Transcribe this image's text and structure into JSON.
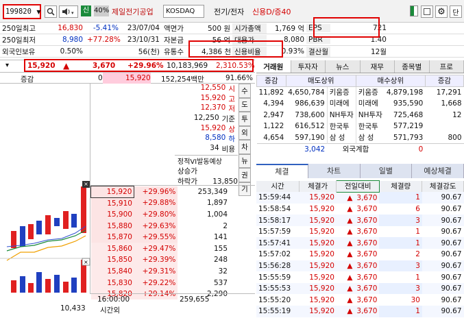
{
  "toolbar": {
    "stock_code": "199820",
    "market_badge": "신",
    "margin_rate": "40%",
    "stock_name": "제일전기공업",
    "market": "KOSDAQ",
    "sector": "전기/전자",
    "credit": "신용D/증40",
    "right_button": "단"
  },
  "summary": {
    "rows": [
      {
        "label": "250일최고",
        "price": "16,830",
        "pct": "-5.41%",
        "date": "23/07/04",
        "k1": "액면가",
        "v1": "500 원",
        "k2": "시가총액",
        "v2": "1,769 억",
        "k3": "EPS",
        "v3": "721"
      },
      {
        "label": "250일최저",
        "price": "8,980",
        "pct": "+77.28%",
        "date": "23/10/31",
        "k1": "자본금",
        "v1": "56 억",
        "k2": "대용가",
        "v2": "8,080",
        "k3": "PBR",
        "v3": "1.40"
      },
      {
        "label": "외국인보유",
        "price": "0.50%",
        "pct": "",
        "date": "56(천)",
        "k1": "유통수",
        "v1": "4,386 천",
        "k2": "신용비율",
        "v2": "0.93%",
        "k3": "결산월",
        "v3": "12월"
      }
    ]
  },
  "price_bar": {
    "price": "15,920",
    "arrow": "▲",
    "change": "3,670",
    "rate": "+29.96%",
    "volume": "10,183,969",
    "amount": "2,310.53%"
  },
  "price_bar2": {
    "label": "증감",
    "v1": "0",
    "v2": "15,920",
    "v3": "152,254백만",
    "v4": "91.66%"
  },
  "left_list": [
    {
      "v": "12,550",
      "k": "시"
    },
    {
      "v": "15,920",
      "k": "고"
    },
    {
      "v": "12,370",
      "k": "저"
    },
    {
      "v": "12,250",
      "k": "기준"
    },
    {
      "v": "15,920",
      "k": "상"
    },
    {
      "v": "8,580",
      "k": "하"
    },
    {
      "v": "34",
      "k": "비용"
    }
  ],
  "vi": {
    "title": "정적VI발동예상",
    "l1": "상승가",
    "l2": "하락가",
    "v2": "13,850"
  },
  "side_buttons": [
    "수",
    "도",
    "투",
    "외",
    "차",
    "뉴",
    "권",
    "기"
  ],
  "quotes": [
    {
      "price": "15,920",
      "pct": "+29.96%",
      "vol": "253,349"
    },
    {
      "price": "15,910",
      "pct": "+29.88%",
      "vol": "1,897"
    },
    {
      "price": "15,900",
      "pct": "+29.80%",
      "vol": "1,004"
    },
    {
      "price": "15,880",
      "pct": "+29.63%",
      "vol": "2"
    },
    {
      "price": "15,870",
      "pct": "+29.55%",
      "vol": "141"
    },
    {
      "price": "15,860",
      "pct": "+29.47%",
      "vol": "155"
    },
    {
      "price": "15,850",
      "pct": "+29.39%",
      "vol": "248"
    },
    {
      "price": "15,840",
      "pct": "+29.31%",
      "vol": "32"
    },
    {
      "price": "15,830",
      "pct": "+29.22%",
      "vol": "537"
    },
    {
      "price": "15,820",
      "pct": "+29.14%",
      "vol": "2,290"
    }
  ],
  "bottom_left": {
    "time": "16:00:00",
    "label": "시간외",
    "left_val": "10,433",
    "total": "259,655"
  },
  "right_tabs": [
    "거래원",
    "투자자",
    "뉴스",
    "재무",
    "종목별",
    "프로"
  ],
  "broker": {
    "h1": "증감",
    "h2": "매도상위",
    "h3": "매수상위",
    "h4": "증감",
    "rows": [
      {
        "a": "11,892",
        "b": "4,650,784",
        "c": "키움증",
        "d": "키움증",
        "e": "4,879,198",
        "f": "17,291"
      },
      {
        "a": "4,394",
        "b": "986,639",
        "c": "미래에",
        "d": "미래에",
        "e": "935,590",
        "f": "1,668"
      },
      {
        "a": "2,947",
        "b": "738,600",
        "c": "NH투자",
        "d": "NH투자",
        "e": "725,468",
        "f": "12"
      },
      {
        "a": "1,122",
        "b": "616,512",
        "c": "한국투",
        "d": "한국투",
        "e": "577,219",
        "f": ""
      },
      {
        "a": "4,654",
        "b": "597,190",
        "c": "삼 성",
        "d": "삼 성",
        "e": "571,793",
        "f": "800"
      }
    ],
    "foreign_left": "3,042",
    "foreign_label": "외국계합",
    "foreign_right": "0"
  },
  "bottom_tabs": [
    "체결",
    "차트",
    "일별",
    "예상체결"
  ],
  "trades": {
    "headers": [
      "시간",
      "체결가",
      "전일대비",
      "체결량",
      "체결강도"
    ],
    "rows": [
      {
        "t": "15:59:44",
        "p": "15,920",
        "c": "3,670",
        "q": "1",
        "s": "90.67"
      },
      {
        "t": "15:58:54",
        "p": "15,920",
        "c": "3,670",
        "q": "6",
        "s": "90.67"
      },
      {
        "t": "15:58:17",
        "p": "15,920",
        "c": "3,670",
        "q": "3",
        "s": "90.67"
      },
      {
        "t": "15:57:59",
        "p": "15,920",
        "c": "3,670",
        "q": "1",
        "s": "90.67"
      },
      {
        "t": "15:57:41",
        "p": "15,920",
        "c": "3,670",
        "q": "1",
        "s": "90.67"
      },
      {
        "t": "15:57:02",
        "p": "15,920",
        "c": "3,670",
        "q": "2",
        "s": "90.67"
      },
      {
        "t": "15:56:28",
        "p": "15,920",
        "c": "3,670",
        "q": "3",
        "s": "90.67"
      },
      {
        "t": "15:55:59",
        "p": "15,920",
        "c": "3,670",
        "q": "1",
        "s": "90.67"
      },
      {
        "t": "15:55:53",
        "p": "15,920",
        "c": "3,670",
        "q": "3",
        "s": "90.67"
      },
      {
        "t": "15:55:20",
        "p": "15,920",
        "c": "3,670",
        "q": "30",
        "s": "90.67"
      },
      {
        "t": "15:55:19",
        "p": "15,920",
        "c": "3,670",
        "q": "1",
        "s": "90.67"
      }
    ]
  },
  "colors": {
    "up": "#d40000",
    "down": "#0030c0",
    "highlight": "#e00000"
  }
}
